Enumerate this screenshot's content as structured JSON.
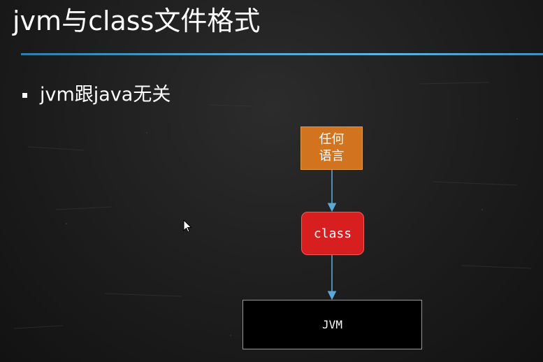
{
  "slide": {
    "title": "jvm与class文件格式",
    "bullet": "jvm跟java无关"
  },
  "diagram": {
    "source_box": {
      "line1": "任何",
      "line2": "语言"
    },
    "class_box": "class",
    "jvm_box": "JVM"
  },
  "colors": {
    "background": "#1d1d1d",
    "title_rule": "#4aa6d6",
    "source_box": "#d2741f",
    "class_box": "#d81f1f",
    "jvm_box": "#000000",
    "arrow": "#5aa9d6"
  },
  "icons": {
    "cursor": "mouse-pointer-icon"
  }
}
